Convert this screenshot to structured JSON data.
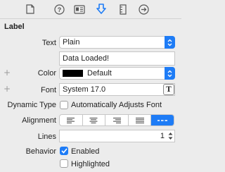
{
  "toolbar": {
    "icons": [
      "file-icon",
      "help-icon",
      "identity-icon",
      "attributes-icon",
      "size-icon",
      "connections-icon"
    ],
    "active_index": 3
  },
  "section": {
    "title": "Label"
  },
  "text": {
    "label": "Text",
    "value": "Plain",
    "content": "Data Loaded!"
  },
  "color": {
    "label": "Color",
    "value": "Default",
    "swatch": "#000000"
  },
  "font": {
    "label": "Font",
    "value": "System 17.0",
    "button_glyph": "T"
  },
  "dynamic_type": {
    "label": "Dynamic Type",
    "option": "Automatically Adjusts Font",
    "checked": false
  },
  "alignment": {
    "label": "Alignment",
    "selected": "justified"
  },
  "lines": {
    "label": "Lines",
    "value": "1"
  },
  "behavior": {
    "label": "Behavior",
    "enabled": {
      "label": "Enabled",
      "checked": true
    },
    "highlighted": {
      "label": "Highlighted",
      "checked": false
    }
  },
  "colors": {
    "accent": "#1e7cf6"
  }
}
